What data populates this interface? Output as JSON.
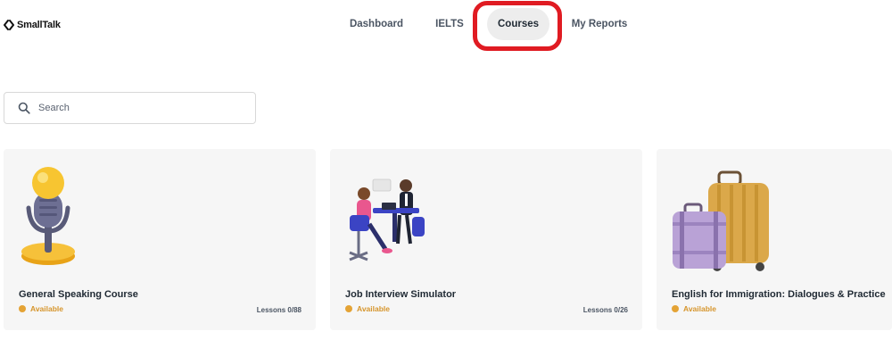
{
  "app": {
    "logo_text": "SmallTalk"
  },
  "nav": {
    "items": [
      {
        "label": "Dashboard"
      },
      {
        "label": "IELTS"
      },
      {
        "label": "Courses"
      },
      {
        "label": "My Reports"
      }
    ],
    "active": "Courses"
  },
  "search": {
    "placeholder": "Search",
    "value": ""
  },
  "courses": [
    {
      "title": "General Speaking Course",
      "status": "Available",
      "lessons": "Lessons 0/88",
      "image": "microphone-icon"
    },
    {
      "title": "Job Interview Simulator",
      "status": "Available",
      "lessons": "Lessons 0/26",
      "image": "interview-illustration"
    },
    {
      "title": "English for Immigration: Dialogues & Practice",
      "status": "Available",
      "lessons": "",
      "image": "suitcases-illustration"
    }
  ],
  "colors": {
    "highlight": "#e01b22",
    "status": "#e4a335",
    "card_bg": "#f6f6f6",
    "active_nav_bg": "#ededed"
  }
}
